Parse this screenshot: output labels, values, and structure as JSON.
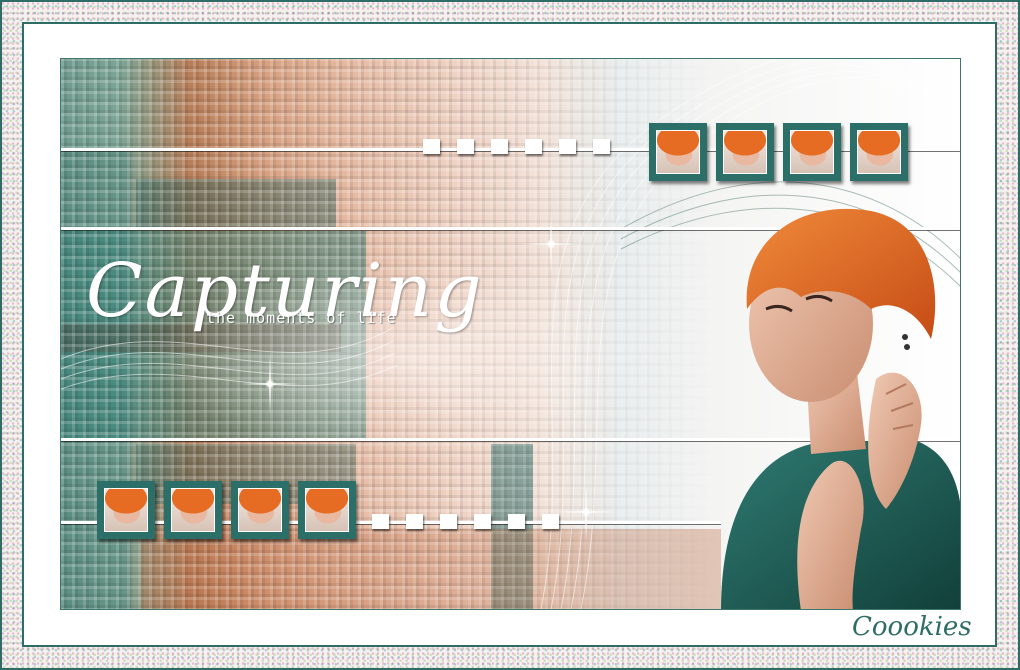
{
  "artwork": {
    "title": "Capturing",
    "subtitle": "the moments of life",
    "signature": "Coookies"
  },
  "colors": {
    "frame": "#2e6d66",
    "teal": "#2b6f68",
    "hair": "#e66b23",
    "dress": "#1e5c55"
  },
  "thumbnails": {
    "top_count": 4,
    "bottom_count": 4
  },
  "squares": {
    "top_count": 6,
    "bottom_count": 6
  }
}
